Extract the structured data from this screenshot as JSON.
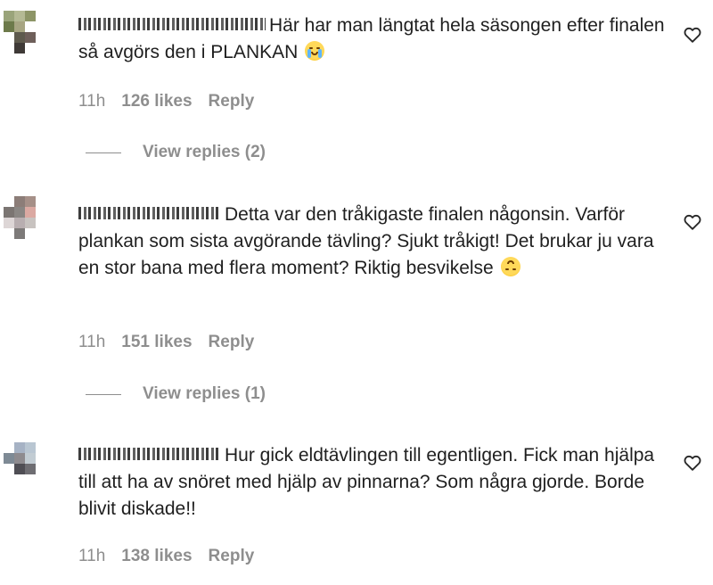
{
  "comments": [
    {
      "text": "Här har man längtat hela säsongen efter finalen så avgörs den i PLANKAN",
      "emoji_icon": "loudly-crying-face-icon",
      "time": "11h",
      "likes": "126 likes",
      "reply_label": "Reply",
      "view_replies": "View replies (2)"
    },
    {
      "text": "Detta var den tråkigaste finalen någonsin. Varför plankan som sista avgörande tävling? Sjukt tråkigt! Det brukar ju vara en stor bana med flera moment? Riktig besvikelse",
      "emoji_icon": "upside-down-face-icon",
      "time": "11h",
      "likes": "151 likes",
      "reply_label": "Reply",
      "view_replies": "View replies (1)"
    },
    {
      "text": "Hur gick eldtävlingen till egentligen. Fick man hjälpa till att ha av snöret med hjälp av pinnarna? Som några gjorde. Borde blivit diskade!!",
      "time": "11h",
      "likes": "138 likes",
      "reply_label": "Reply"
    }
  ],
  "icons": {
    "like": "heart-outline-icon",
    "avatar": "pixelated-avatar-icon"
  },
  "colors": {
    "text": "#1f1f1f",
    "secondary": "#8e8e8e",
    "background": "#ffffff"
  }
}
